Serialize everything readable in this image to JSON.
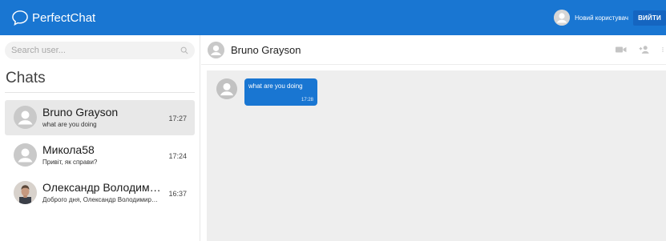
{
  "app": {
    "title": "PerfectChat",
    "accent_color": "#1976d2"
  },
  "header": {
    "user_name": "Новий користувач",
    "logout_label": "ВИЙТИ",
    "avatar_icon": "person-icon"
  },
  "sidebar": {
    "search_placeholder": "Search user...",
    "search_value": "",
    "chats_title": "Chats",
    "chats": [
      {
        "name": "Bruno Grayson",
        "preview": "what are you doing",
        "time": "17:27",
        "active": true,
        "avatar": "person-icon"
      },
      {
        "name": "Микола58",
        "preview": "Привіт, як справи?",
        "time": "17:24",
        "active": false,
        "avatar": "person-icon"
      },
      {
        "name": "Олександр Володимирович",
        "preview": "Доброго дня, Олександр Володимирович",
        "time": "16:37",
        "active": false,
        "avatar": "user-photo"
      }
    ]
  },
  "conversation": {
    "contact_name": "Bruno Grayson",
    "header_icons": [
      "video-camera-icon",
      "add-person-icon",
      "more-vert-icon"
    ],
    "messages": [
      {
        "text": "what are you doing",
        "time": "17:28"
      }
    ]
  }
}
